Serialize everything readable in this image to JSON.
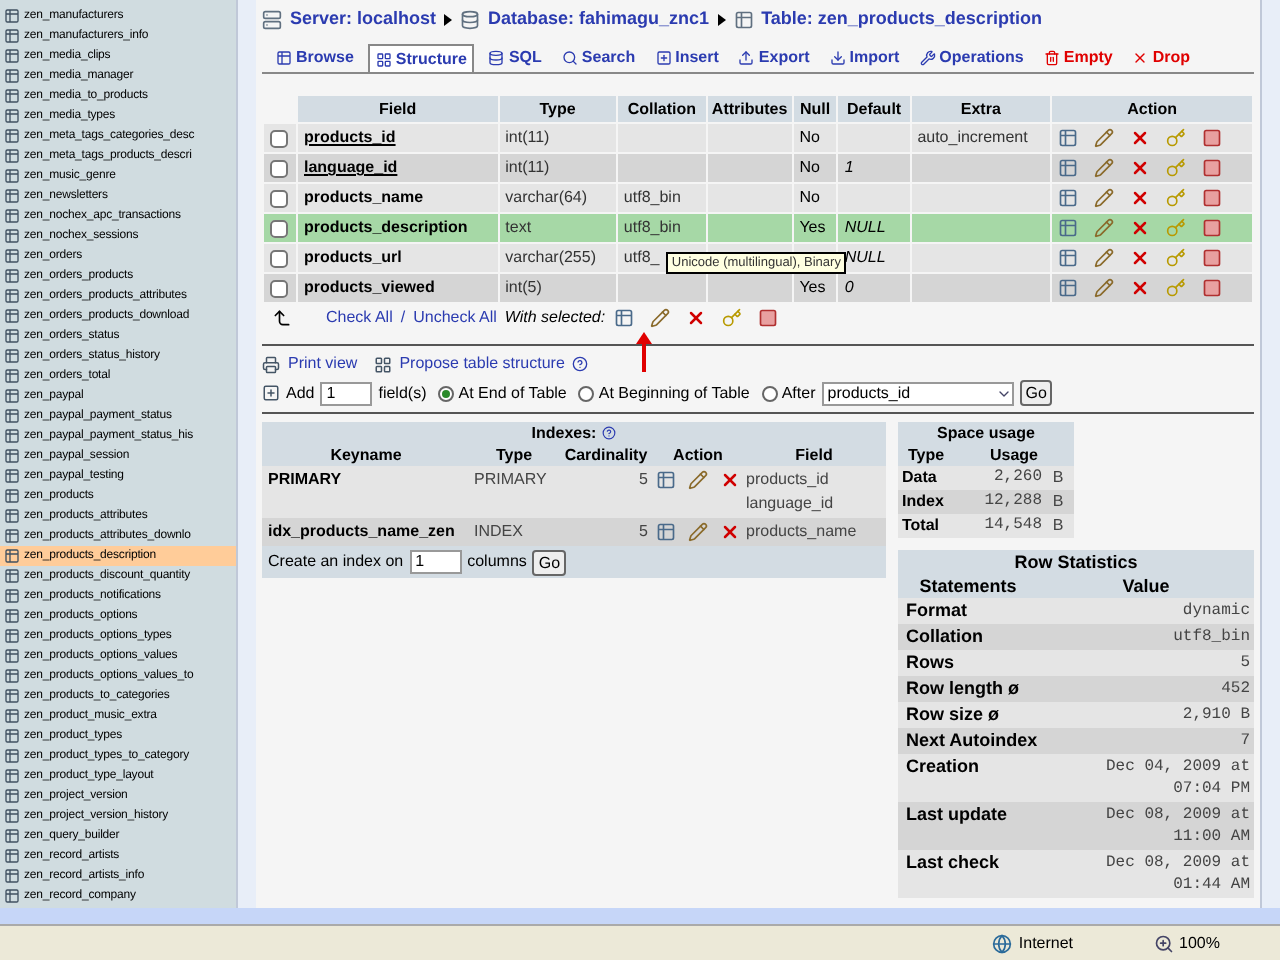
{
  "sidebar": {
    "items": [
      {
        "label": "zen_manufacturers",
        "selected": false
      },
      {
        "label": "zen_manufacturers_info",
        "selected": false
      },
      {
        "label": "zen_media_clips",
        "selected": false
      },
      {
        "label": "zen_media_manager",
        "selected": false
      },
      {
        "label": "zen_media_to_products",
        "selected": false
      },
      {
        "label": "zen_media_types",
        "selected": false
      },
      {
        "label": "zen_meta_tags_categories_desc",
        "selected": false
      },
      {
        "label": "zen_meta_tags_products_descri",
        "selected": false
      },
      {
        "label": "zen_music_genre",
        "selected": false
      },
      {
        "label": "zen_newsletters",
        "selected": false
      },
      {
        "label": "zen_nochex_apc_transactions",
        "selected": false
      },
      {
        "label": "zen_nochex_sessions",
        "selected": false
      },
      {
        "label": "zen_orders",
        "selected": false
      },
      {
        "label": "zen_orders_products",
        "selected": false
      },
      {
        "label": "zen_orders_products_attributes",
        "selected": false
      },
      {
        "label": "zen_orders_products_download",
        "selected": false
      },
      {
        "label": "zen_orders_status",
        "selected": false
      },
      {
        "label": "zen_orders_status_history",
        "selected": false
      },
      {
        "label": "zen_orders_total",
        "selected": false
      },
      {
        "label": "zen_paypal",
        "selected": false
      },
      {
        "label": "zen_paypal_payment_status",
        "selected": false
      },
      {
        "label": "zen_paypal_payment_status_his",
        "selected": false
      },
      {
        "label": "zen_paypal_session",
        "selected": false
      },
      {
        "label": "zen_paypal_testing",
        "selected": false
      },
      {
        "label": "zen_products",
        "selected": false
      },
      {
        "label": "zen_products_attributes",
        "selected": false
      },
      {
        "label": "zen_products_attributes_downlo",
        "selected": false
      },
      {
        "label": "zen_products_description",
        "selected": true
      },
      {
        "label": "zen_products_discount_quantity",
        "selected": false
      },
      {
        "label": "zen_products_notifications",
        "selected": false
      },
      {
        "label": "zen_products_options",
        "selected": false
      },
      {
        "label": "zen_products_options_types",
        "selected": false
      },
      {
        "label": "zen_products_options_values",
        "selected": false
      },
      {
        "label": "zen_products_options_values_to",
        "selected": false
      },
      {
        "label": "zen_products_to_categories",
        "selected": false
      },
      {
        "label": "zen_product_music_extra",
        "selected": false
      },
      {
        "label": "zen_product_types",
        "selected": false
      },
      {
        "label": "zen_product_types_to_category",
        "selected": false
      },
      {
        "label": "zen_product_type_layout",
        "selected": false
      },
      {
        "label": "zen_project_version",
        "selected": false
      },
      {
        "label": "zen_project_version_history",
        "selected": false
      },
      {
        "label": "zen_query_builder",
        "selected": false
      },
      {
        "label": "zen_record_artists",
        "selected": false
      },
      {
        "label": "zen_record_artists_info",
        "selected": false
      },
      {
        "label": "zen_record_company",
        "selected": false
      }
    ]
  },
  "breadcrumb": [
    "Server: localhost",
    "Database: fahimagu_znc1",
    "Table: zen_products_description"
  ],
  "tabs": [
    {
      "label": "Browse",
      "selected": false,
      "kind": "normal"
    },
    {
      "label": "Structure",
      "selected": true,
      "kind": "normal"
    },
    {
      "label": "SQL",
      "selected": false,
      "kind": "normal"
    },
    {
      "label": "Search",
      "selected": false,
      "kind": "normal"
    },
    {
      "label": "Insert",
      "selected": false,
      "kind": "normal"
    },
    {
      "label": "Export",
      "selected": false,
      "kind": "normal"
    },
    {
      "label": "Import",
      "selected": false,
      "kind": "normal"
    },
    {
      "label": "Operations",
      "selected": false,
      "kind": "normal"
    },
    {
      "label": "Empty",
      "selected": false,
      "kind": "danger"
    },
    {
      "label": "Drop",
      "selected": false,
      "kind": "danger"
    }
  ],
  "structure": {
    "columns": [
      "Field",
      "Type",
      "Collation",
      "Attributes",
      "Null",
      "Default",
      "Extra",
      "Action"
    ],
    "rows": [
      {
        "field": "products_id",
        "key": true,
        "type": "int(11)",
        "null": "No",
        "extra": "auto_increment",
        "highlighted": false,
        "checked": false
      },
      {
        "field": "language_id",
        "key": true,
        "type": "int(11)",
        "null": "No",
        "default": "1",
        "highlighted": false,
        "checked": false
      },
      {
        "field": "products_name",
        "key": false,
        "type": "varchar(64)",
        "collation": "utf8_bin",
        "null": "No",
        "highlighted": false,
        "checked": false
      },
      {
        "field": "products_description",
        "key": false,
        "type": "text",
        "collation": "utf8_bin",
        "null": "Yes",
        "default": "NULL",
        "highlighted": true,
        "checked": false
      },
      {
        "field": "products_url",
        "key": false,
        "type": "varchar(255)",
        "collation": "utf8_",
        "tooltip": "Unicode (multilingual), Binary",
        "default": "NULL",
        "highlighted": false,
        "checked": false
      },
      {
        "field": "products_viewed",
        "key": false,
        "type": "int(5)",
        "null": "Yes",
        "default": "0",
        "highlighted": false,
        "checked": false
      }
    ],
    "check_all": "Check All",
    "check_separator": "/",
    "uncheck_all": "Uncheck All",
    "with_selected": "With selected:"
  },
  "links": {
    "print_view": "Print view",
    "propose": "Propose table structure"
  },
  "add_field": {
    "label": "Add",
    "value": "1",
    "unit": "field(s)",
    "options": [
      {
        "label": "At End of Table",
        "selected": true
      },
      {
        "label": "At Beginning of Table",
        "selected": false
      },
      {
        "label": "After",
        "selected": false
      }
    ],
    "after_value": "products_id",
    "go": "Go"
  },
  "indexes": {
    "title": "Indexes:",
    "columns": [
      "Keyname",
      "Type",
      "Cardinality",
      "Action",
      "Field"
    ],
    "rows": [
      {
        "keyname": "PRIMARY",
        "type": "PRIMARY",
        "cardinality": "5",
        "fields": [
          "products_id",
          "language_id"
        ]
      },
      {
        "keyname": "idx_products_name_zen",
        "type": "INDEX",
        "cardinality": "5",
        "fields": [
          "products_name"
        ]
      }
    ],
    "create_label": "Create an index on",
    "create_value": "1",
    "create_unit": "columns",
    "go": "Go"
  },
  "space_usage": {
    "title": "Space usage",
    "columns": [
      "Type",
      "Usage"
    ],
    "rows": [
      {
        "type": "Data",
        "usage": "2,260",
        "unit": "B"
      },
      {
        "type": "Index",
        "usage": "12,288",
        "unit": "B"
      },
      {
        "type": "Total",
        "usage": "14,548",
        "unit": "B"
      }
    ]
  },
  "row_statistics": {
    "title": "Row Statistics",
    "columns": [
      "Statements",
      "Value"
    ],
    "rows": [
      {
        "statement": "Format",
        "value": "dynamic"
      },
      {
        "statement": "Collation",
        "value": "utf8_bin"
      },
      {
        "statement": "Rows",
        "value": "5"
      },
      {
        "statement": "Row length ø",
        "value": "452"
      },
      {
        "statement": "Row size ø",
        "value": "2,910 B"
      },
      {
        "statement": "Next Autoindex",
        "value": "7"
      },
      {
        "statement": "Creation",
        "value": "Dec 04, 2009 at 07:04 PM"
      },
      {
        "statement": "Last update",
        "value": "Dec 08, 2009 at 11:00 AM"
      },
      {
        "statement": "Last check",
        "value": "Dec 08, 2009 at 01:44 AM"
      }
    ]
  },
  "status_bar": {
    "zone": "Internet",
    "zoom": "100%"
  }
}
